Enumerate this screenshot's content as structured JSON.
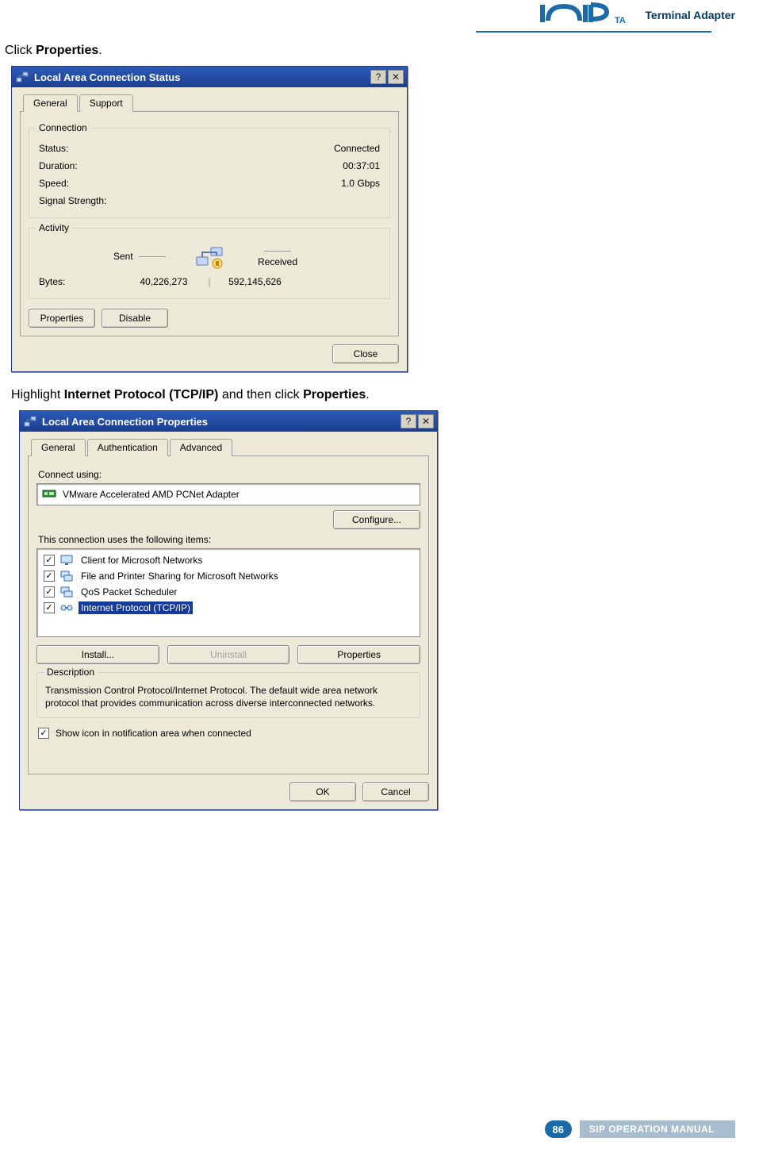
{
  "header": {
    "brand_text": "Terminal Adapter"
  },
  "instructions": {
    "step1_prefix": "Click ",
    "step1_bold": "Properties",
    "step1_suffix": ".",
    "step2_prefix": "Highlight ",
    "step2_bold1": "Internet Protocol (TCP/IP)",
    "step2_mid": " and then click ",
    "step2_bold2": "Properties",
    "step2_suffix": "."
  },
  "status_dialog": {
    "title": "Local Area Connection Status",
    "help_btn": "?",
    "close_btn": "✕",
    "tabs": {
      "general": "General",
      "support": "Support"
    },
    "connection": {
      "legend": "Connection",
      "status_label": "Status:",
      "status_value": "Connected",
      "duration_label": "Duration:",
      "duration_value": "00:37:01",
      "speed_label": "Speed:",
      "speed_value": "1.0 Gbps",
      "signal_label": "Signal Strength:"
    },
    "activity": {
      "legend": "Activity",
      "sent_label": "Sent",
      "received_label": "Received",
      "bytes_label": "Bytes:",
      "sent_value": "40,226,273",
      "received_value": "592,145,626"
    },
    "buttons": {
      "properties": "Properties",
      "disable": "Disable",
      "close": "Close"
    }
  },
  "props_dialog": {
    "title": "Local Area Connection Properties",
    "help_btn": "?",
    "close_btn": "✕",
    "tabs": {
      "general": "General",
      "authentication": "Authentication",
      "advanced": "Advanced"
    },
    "connect_using_label": "Connect using:",
    "adapter_name": "VMware Accelerated AMD PCNet Adapter",
    "configure_btn": "Configure...",
    "items_label": "This connection uses the following items:",
    "items": [
      {
        "checked": true,
        "text": "Client for Microsoft Networks",
        "selected": false,
        "icon": "monitor"
      },
      {
        "checked": true,
        "text": "File and Printer Sharing for Microsoft Networks",
        "selected": false,
        "icon": "share"
      },
      {
        "checked": true,
        "text": "QoS Packet Scheduler",
        "selected": false,
        "icon": "share"
      },
      {
        "checked": true,
        "text": "Internet Protocol (TCP/IP)",
        "selected": true,
        "icon": "proto"
      }
    ],
    "buttons": {
      "install": "Install...",
      "uninstall": "Uninstall",
      "properties": "Properties",
      "ok": "OK",
      "cancel": "Cancel"
    },
    "description": {
      "legend": "Description",
      "text": "Transmission Control Protocol/Internet Protocol. The default wide area network protocol that provides communication across diverse interconnected networks."
    },
    "show_icon_label": "Show icon in notification area when connected"
  },
  "footer": {
    "page_number": "86",
    "manual_title": "SIP OPERATION MANUAL"
  }
}
